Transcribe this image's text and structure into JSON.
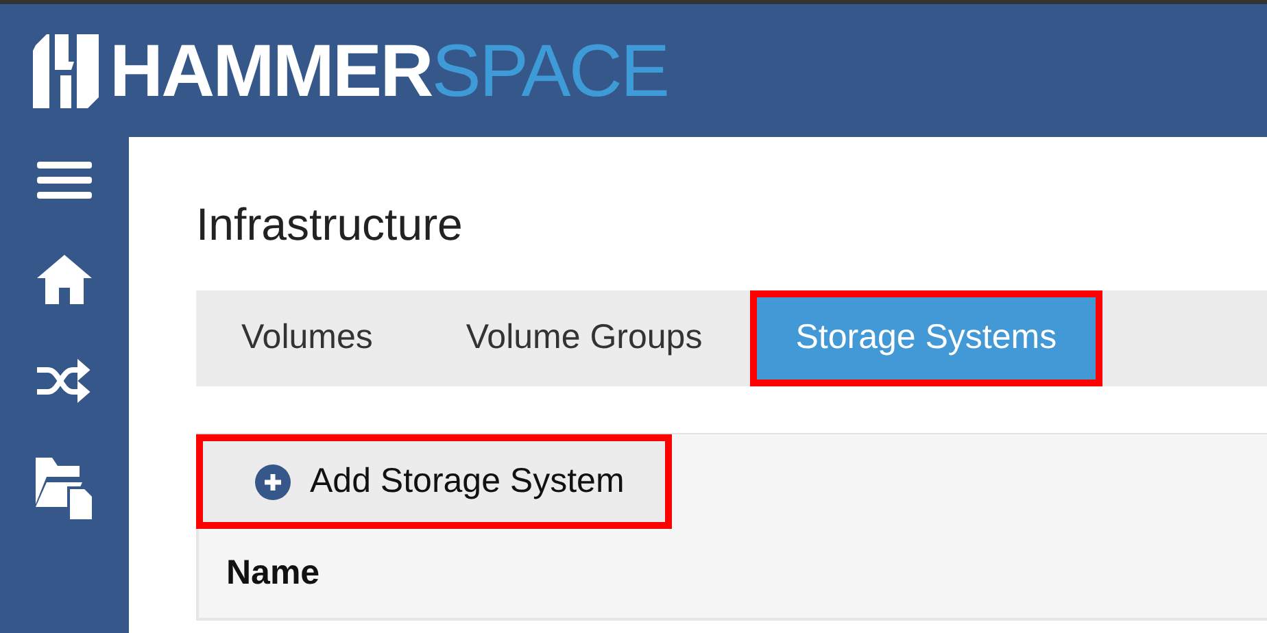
{
  "logo": {
    "text_bold": "HAMMER",
    "text_light": "SPACE"
  },
  "sidebar": {
    "items": [
      {
        "kind": "menu"
      },
      {
        "kind": "home"
      },
      {
        "kind": "shuffle"
      },
      {
        "kind": "files"
      }
    ]
  },
  "page": {
    "title": "Infrastructure"
  },
  "tabs": [
    {
      "label": "Volumes",
      "selected": false,
      "highlighted": false
    },
    {
      "label": "Volume Groups",
      "selected": false,
      "highlighted": false
    },
    {
      "label": "Storage Systems",
      "selected": true,
      "highlighted": true
    }
  ],
  "toolbar": {
    "add_button": {
      "label": "Add Storage System",
      "highlighted": true
    }
  },
  "table": {
    "columns": [
      "Name"
    ]
  }
}
